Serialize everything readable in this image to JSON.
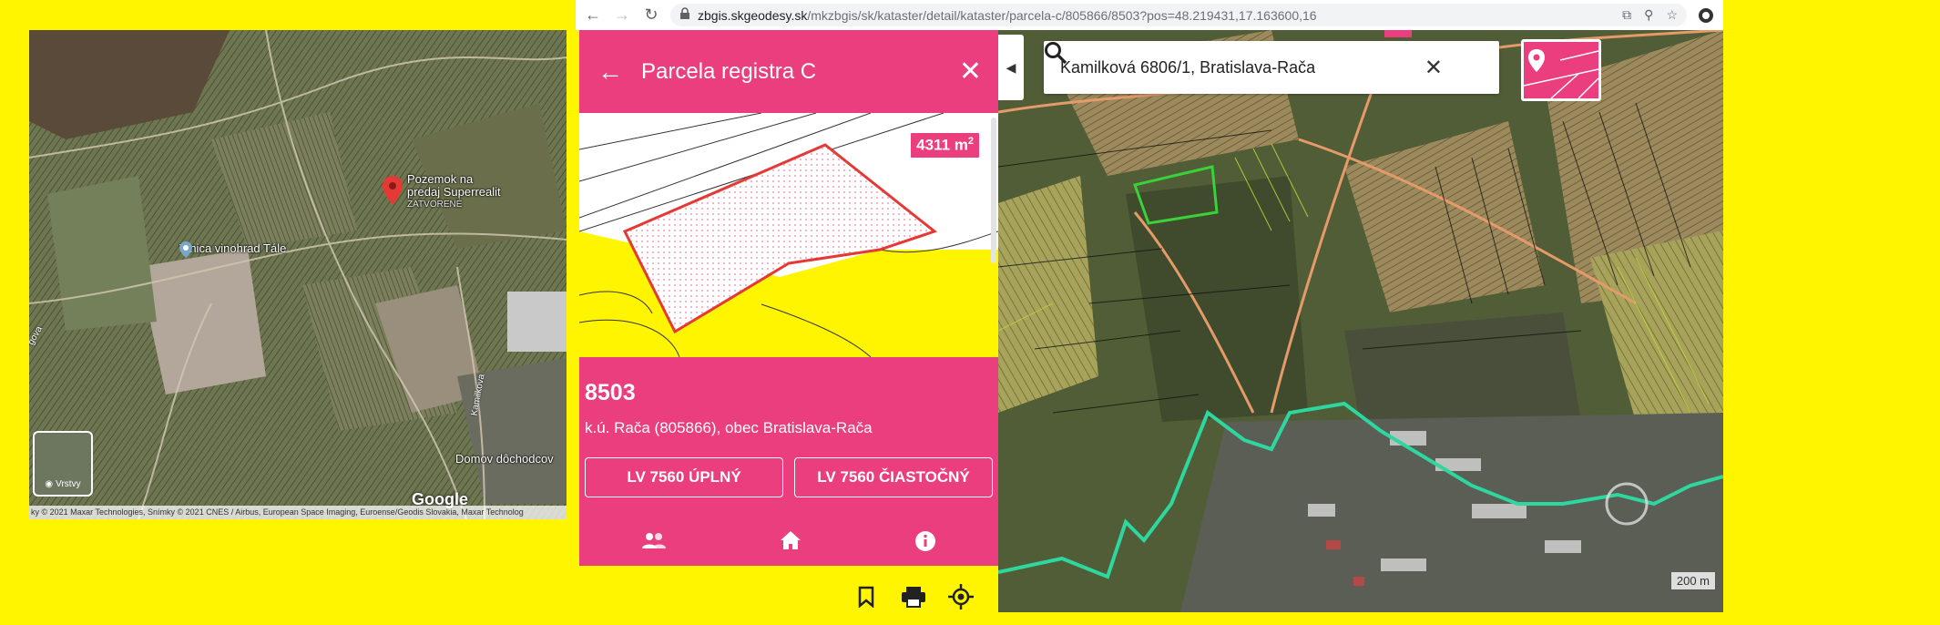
{
  "browser": {
    "url_host": "zbgis.skgeodesy.sk",
    "url_path": "/mkzbgis/sk/kataster/detail/kataster/parcela-c/805866/8503?pos=48.219431,17.163600,16"
  },
  "gmap": {
    "poi_name_line1": "Pozemok na",
    "poi_name_line2": "predaj Superrealit",
    "poi_status": "ZATVORENÉ",
    "vinica": "Vinica vinohrad Tále",
    "domov": "Domov dôchodcov",
    "street_kamilkova": "Kamilkova",
    "street_left": "gova",
    "layers_label": "Vrstvy",
    "google": "Google",
    "attribution": "ky © 2021 Maxar Technologies, Snímky © 2021 CNES / Airbus, European Space Imaging, Euroense/Geodis Slovakia, Maxar Technolog"
  },
  "panel": {
    "title": "Parcela registra C",
    "area_value": "4311 m",
    "area_unit_sup": "2",
    "parcel_number": "8503",
    "description": "k.ú. Rača (805866), obec Bratislava-Rača",
    "btn_full": "LV 7560 ÚPLNÝ",
    "btn_partial": "LV 7560 ČIASTOČNÝ",
    "accent": "#ea3e7e"
  },
  "cmap": {
    "search_query": "Kamilková 6806/1, Bratislava-Rača",
    "scale_label": "200 m"
  }
}
